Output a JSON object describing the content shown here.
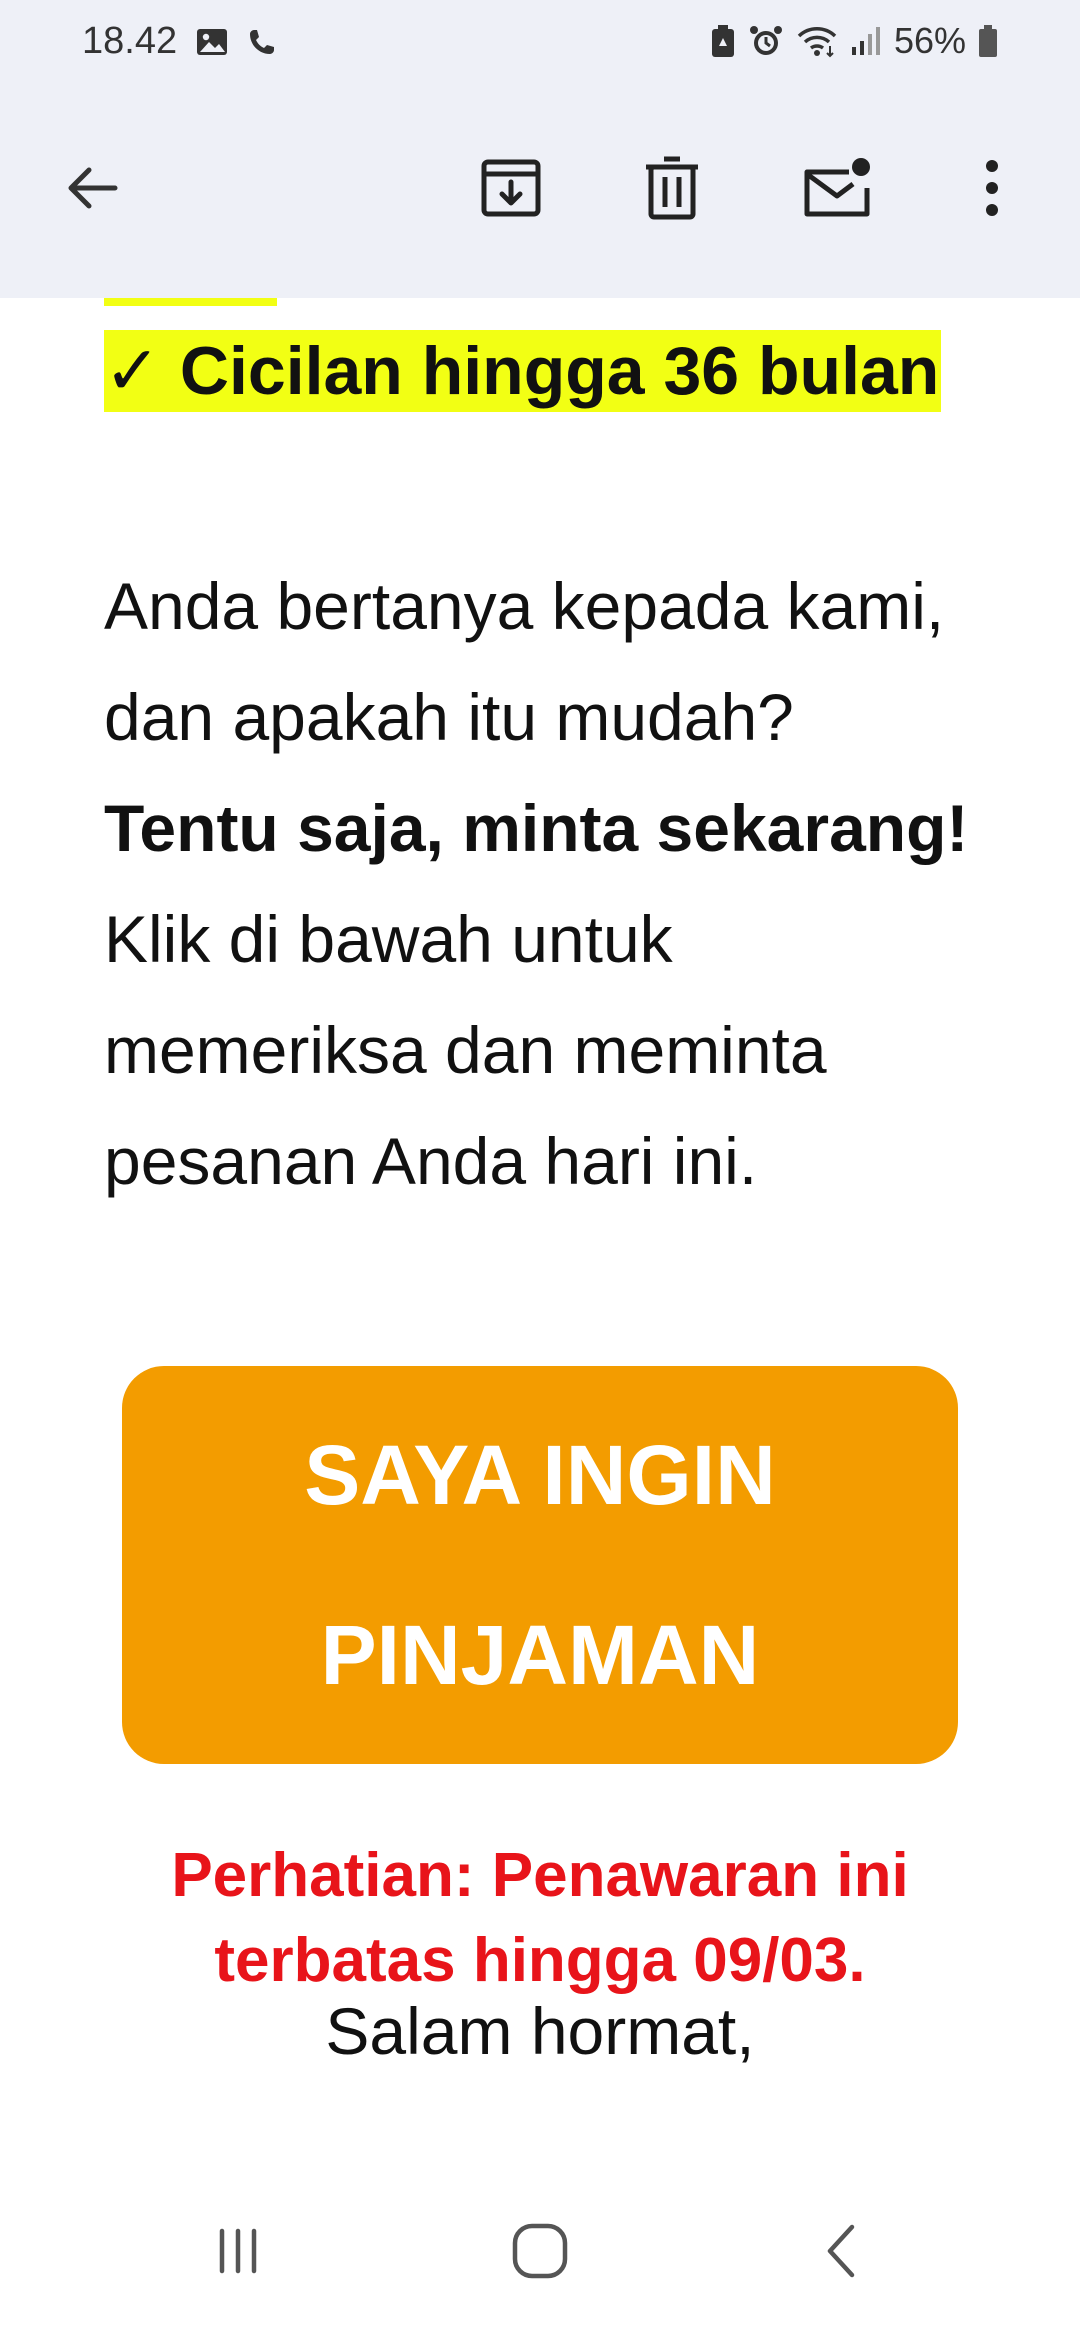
{
  "status_bar": {
    "time": "18.42",
    "battery": "56%"
  },
  "toolbar": {
    "back": "back-arrow-icon",
    "archive": "archive-icon",
    "delete": "trash-icon",
    "mark_unread": "mail-unread-icon",
    "more": "more-vert-icon"
  },
  "email": {
    "benefit_line": "✓ Cicilan hingga 36 bulan",
    "paragraph_plain": "Anda bertanya kepada kami, dan apakah itu mudah? ",
    "paragraph_bold": "Tentu saja, minta sekarang!",
    "paragraph_cta_text": "Klik di bawah untuk memeriksa dan meminta pesanan Anda hari ini.",
    "cta_button_label": "SAYA INGIN PINJAMAN",
    "notice": "Perhatian: Penawaran ini terbatas hingga 09/03.",
    "closing": "Salam hormat,"
  },
  "colors": {
    "highlight": "#f2ff14",
    "cta_background": "#f39c00",
    "notice_text": "#e8141a",
    "chrome_background": "#eef0f7"
  },
  "nav_bar": {
    "recents": "recents-icon",
    "home": "home-icon",
    "back": "nav-back-icon"
  }
}
